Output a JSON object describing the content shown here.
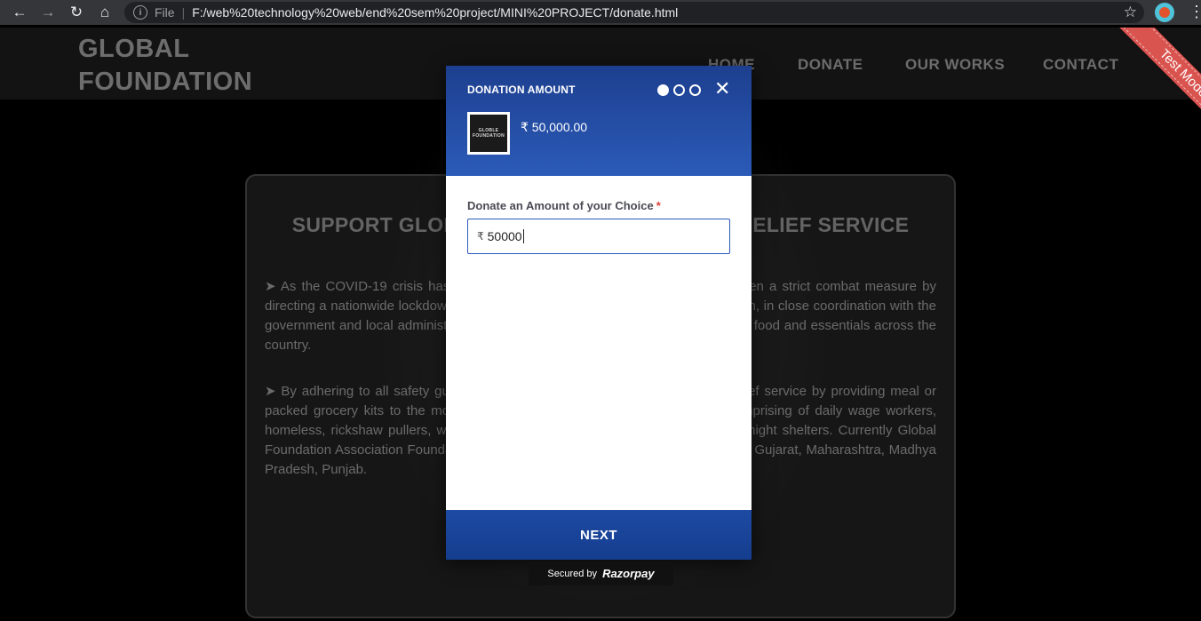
{
  "browser": {
    "scheme": "File",
    "url": "F:/web%20technology%20web/end%20sem%20project/MINI%20PROJECT/donate.html"
  },
  "site": {
    "logo_line1": "GLOBAL",
    "logo_line2": "FOUNDATION",
    "nav": [
      "HOME",
      "DONATE",
      "OUR WORKS",
      "CONTACT"
    ],
    "section_title": "SUPPORT GLOBAL FOUNDATION COVID-19 RELIEF SERVICE",
    "paragraph1": "➤ As the COVID-19 crisis has gripped the nation, Government of India has taken a strict combat measure by directing a nationwide lockdown. In this great hour of need, The Global Foundation, in close coordination with the government and local administration, has stepped in to provide relief by providing food and essentials across the country.",
    "paragraph2": "➤ By adhering to all safety guidelines, the Global Foundation has begun its relief service by providing meal or packed grocery kits to the most vulnerable income segment of the society comprising of daily wage workers, homeless, rickshaw pullers, workers, and needy people at old age homes and night shelters. Currently Global Foundation Association Foundations are providing food relief in, Rajasthan, Delhi, Gujarat, Maharashtra, Madhya Pradesh, Punjab."
  },
  "ribbon": {
    "label": "Test Mode"
  },
  "checkout": {
    "header_title": "DONATION AMOUNT",
    "merchant_logo_line1": "GLOBLE",
    "merchant_logo_line2": "FOUNDATION",
    "amount_display": "₹ 50,000.00",
    "field_label": "Donate an Amount of your Choice",
    "required_mark": "*",
    "currency_symbol": "₹",
    "amount_value": "50000",
    "next_label": "NEXT",
    "steps_total": 3,
    "step_current": 1,
    "close_icon": "close-icon"
  },
  "footer": {
    "secured_by": "Secured by",
    "brand": "Razorpay"
  },
  "colors": {
    "header_blue": "#2b5bb8",
    "button_blue": "#1d4aa3",
    "ribbon_red": "#d9534f"
  }
}
